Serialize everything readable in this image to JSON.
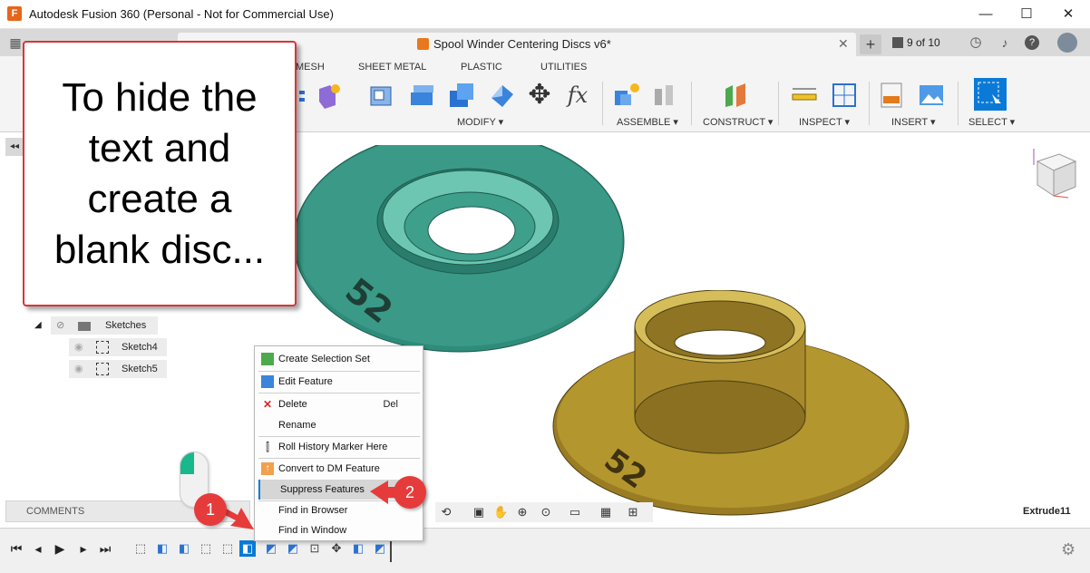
{
  "window": {
    "app_icon": "F",
    "title": "Autodesk Fusion 360 (Personal - Not for Commercial Use)",
    "minimize": "—",
    "maximize": "☐",
    "close": "✕"
  },
  "document": {
    "title": "Spool Winder Centering Discs v6*",
    "close": "✕",
    "new_tab": "+",
    "versions": "9 of 10"
  },
  "ribbon": {
    "tabs": [
      "MESH",
      "SHEET METAL",
      "PLASTIC",
      "UTILITIES"
    ],
    "groups": [
      "MODIFY ▾",
      "ASSEMBLE ▾",
      "CONSTRUCT ▾",
      "INSPECT ▾",
      "INSERT ▾",
      "SELECT ▾"
    ]
  },
  "browser": {
    "toggle": "◂◂",
    "sketches_label": "Sketches",
    "items": [
      "Sketch4",
      "Sketch5"
    ]
  },
  "callout": {
    "lines": [
      "To hide the",
      "text and",
      "create a",
      "blank disc..."
    ],
    "accent": "#d7363a"
  },
  "context_menu": {
    "items": [
      {
        "label": "Create Selection Set",
        "icon": "selection-set-icon",
        "shortcut": ""
      },
      {
        "label": "Edit Feature",
        "icon": "edit-feature-icon",
        "shortcut": ""
      },
      {
        "label": "Delete",
        "icon": "delete-icon",
        "shortcut": "Del"
      },
      {
        "label": "Rename",
        "icon": "",
        "shortcut": ""
      },
      {
        "label": "Roll History Marker Here",
        "icon": "roll-history-icon",
        "shortcut": ""
      },
      {
        "label": "Convert to DM Feature",
        "icon": "convert-dm-icon",
        "shortcut": ""
      },
      {
        "label": "Suppress Features",
        "icon": "",
        "shortcut": ""
      },
      {
        "label": "Find in Browser",
        "icon": "",
        "shortcut": ""
      },
      {
        "label": "Find in Window",
        "icon": "",
        "shortcut": ""
      }
    ],
    "highlighted": "Suppress Features"
  },
  "badges": [
    "1",
    "2"
  ],
  "comments_label": "COMMENTS",
  "status": {
    "selected_feature": "Extrude11"
  },
  "disc_labels": [
    "52",
    "52"
  ],
  "colors": {
    "teal_disc": "#2f8c7a",
    "gold_disc": "#a88a2c",
    "badge_red": "#e63b3b",
    "highlight_blue": "#0b7bd6"
  }
}
